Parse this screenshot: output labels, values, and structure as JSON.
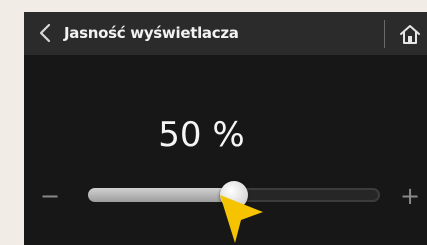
{
  "header": {
    "back_icon": "chevron-left-icon",
    "title": "Jasność wyświetlacza",
    "home_icon": "home-icon"
  },
  "brightness": {
    "value_text": "50 %",
    "value_percent": 50,
    "minus_label": "−",
    "plus_label": "+"
  },
  "overlay": {
    "pointer_icon": "arrow-pointer-icon",
    "pointer_color": "#f6c300"
  },
  "colors": {
    "screen_bg": "#171717",
    "header_bg": "#2b2b2b",
    "frame_bg": "#f2ece6"
  }
}
